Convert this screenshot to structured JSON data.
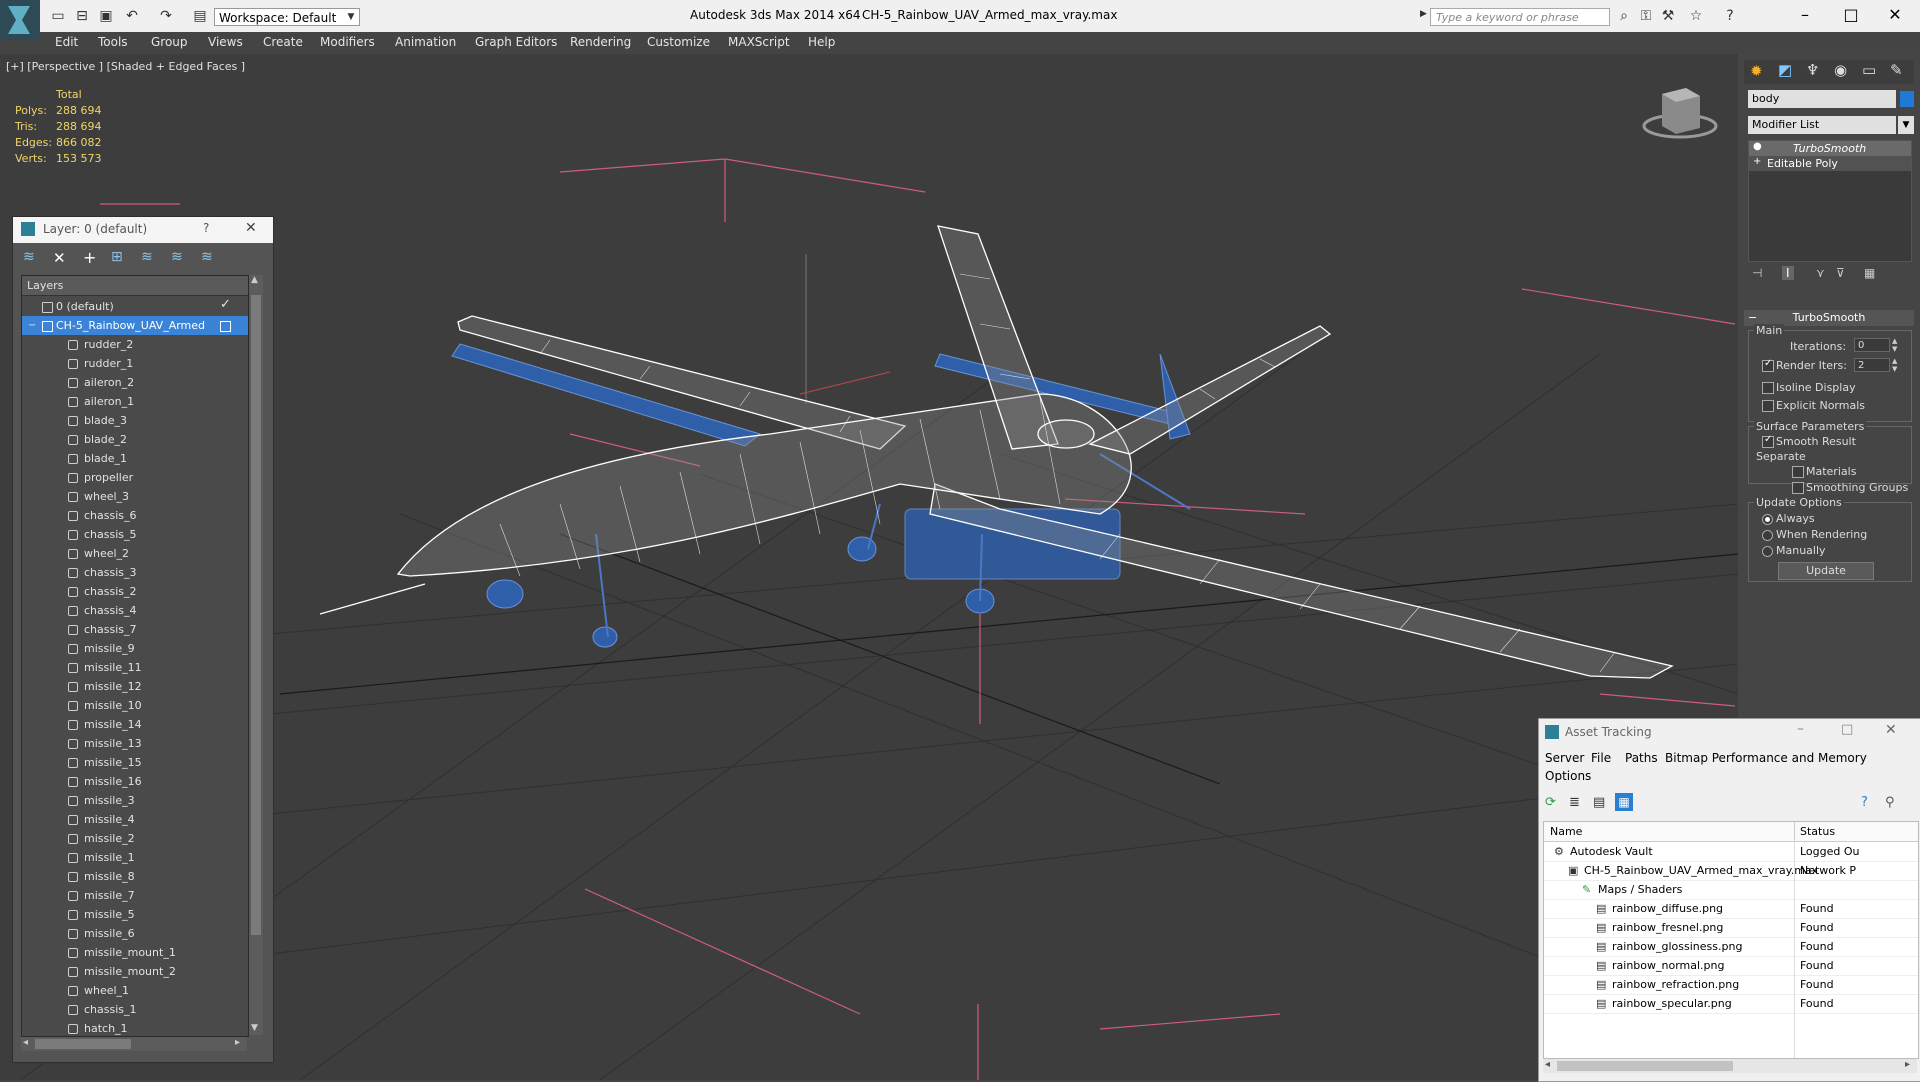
{
  "titlebar": {
    "app_title": "Autodesk 3ds Max  2014 x64",
    "file_title": "CH-5_Rainbow_UAV_Armed_max_vray.max",
    "workspace_label": "Workspace: Default",
    "search_placeholder": "Type a keyword or phrase"
  },
  "menubar": [
    "Edit",
    "Tools",
    "Group",
    "Views",
    "Create",
    "Modifiers",
    "Animation",
    "Graph Editors",
    "Rendering",
    "Customize",
    "MAXScript",
    "Help"
  ],
  "viewport": {
    "label": "[+] [Perspective ] [Shaded + Edged Faces ]",
    "stats_header": "Total",
    "stats": [
      {
        "label": "Polys:",
        "value": "288 694"
      },
      {
        "label": "Tris:",
        "value": "288 694"
      },
      {
        "label": "Edges:",
        "value": "866 082"
      },
      {
        "label": "Verts:",
        "value": "153 573"
      }
    ]
  },
  "layer_dialog": {
    "title": "Layer: 0 (default)",
    "help": "?",
    "column_header": "Layers",
    "layers": [
      {
        "name": "0 (default)",
        "checked": true
      },
      {
        "name": "CH-5_Rainbow_UAV_Armed",
        "selected": true
      }
    ],
    "objects": [
      "rudder_2",
      "rudder_1",
      "aileron_2",
      "aileron_1",
      "blade_3",
      "blade_2",
      "blade_1",
      "propeller",
      "wheel_3",
      "chassis_6",
      "chassis_5",
      "wheel_2",
      "chassis_3",
      "chassis_2",
      "chassis_4",
      "chassis_7",
      "missile_9",
      "missile_11",
      "missile_12",
      "missile_10",
      "missile_14",
      "missile_13",
      "missile_15",
      "missile_16",
      "missile_3",
      "missile_4",
      "missile_2",
      "missile_1",
      "missile_8",
      "missile_7",
      "missile_5",
      "missile_6",
      "missile_mount_1",
      "missile_mount_2",
      "wheel_1",
      "chassis_1",
      "hatch_1"
    ]
  },
  "command_panel": {
    "object_name": "body",
    "object_color": "#1e7ad6",
    "modifier_list": "Modifier List",
    "stack": [
      "TurboSmooth",
      "Editable Poly"
    ],
    "rollout_title": "TurboSmooth",
    "main_group": "Main",
    "iterations_label": "Iterations:",
    "iterations_value": "0",
    "render_iters_label": "Render Iters:",
    "render_iters_value": "2",
    "render_iters_checked": true,
    "isoline_label": "Isoline Display",
    "explicit_normals_label": "Explicit Normals",
    "surface_group": "Surface Parameters",
    "smooth_result_label": "Smooth Result",
    "smooth_result_checked": true,
    "separate_label": "Separate",
    "materials_label": "Materials",
    "smoothing_groups_label": "Smoothing Groups",
    "update_group": "Update Options",
    "update_options": [
      "Always",
      "When Rendering",
      "Manually"
    ],
    "update_selected": "Always",
    "update_button": "Update"
  },
  "asset_tracking": {
    "title": "Asset Tracking",
    "menu": [
      "Server",
      "File",
      "Paths",
      "Bitmap Performance and Memory",
      "Options"
    ],
    "col_name": "Name",
    "col_status": "Status",
    "rows": [
      {
        "name": "Autodesk Vault",
        "status": "Logged Ou",
        "level": 1,
        "icon": "vault-icon"
      },
      {
        "name": "CH-5_Rainbow_UAV_Armed_max_vray.max",
        "status": "Network P",
        "level": 2,
        "icon": "max-file-icon"
      },
      {
        "name": "Maps / Shaders",
        "status": "",
        "level": 3,
        "icon": "maps-icon"
      },
      {
        "name": "rainbow_diffuse.png",
        "status": "Found",
        "level": 4,
        "icon": "image-file-icon"
      },
      {
        "name": "rainbow_fresnel.png",
        "status": "Found",
        "level": 4,
        "icon": "image-file-icon"
      },
      {
        "name": "rainbow_glossiness.png",
        "status": "Found",
        "level": 4,
        "icon": "image-file-icon"
      },
      {
        "name": "rainbow_normal.png",
        "status": "Found",
        "level": 4,
        "icon": "image-file-icon"
      },
      {
        "name": "rainbow_refraction.png",
        "status": "Found",
        "level": 4,
        "icon": "image-file-icon"
      },
      {
        "name": "rainbow_specular.png",
        "status": "Found",
        "level": 4,
        "icon": "image-file-icon"
      }
    ]
  }
}
